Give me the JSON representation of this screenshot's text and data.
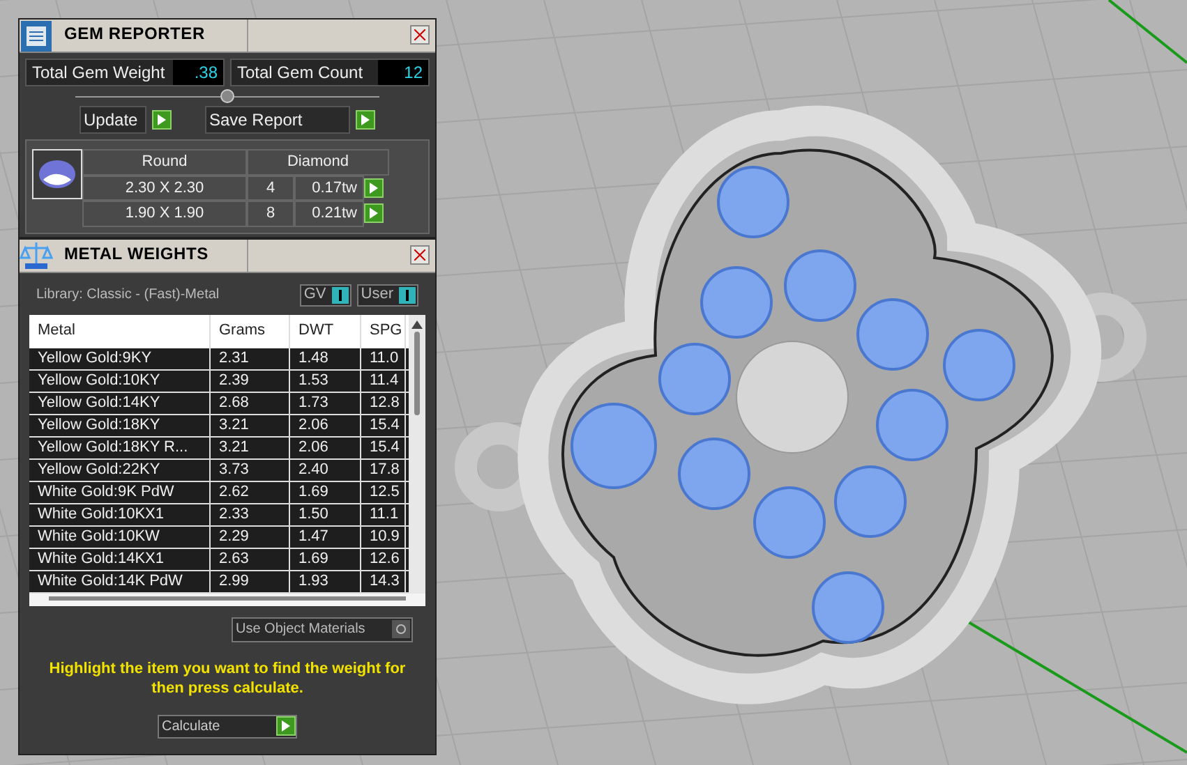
{
  "gem_reporter": {
    "title": "GEM REPORTER",
    "total_weight": {
      "label": "Total Gem Weight",
      "value": ".38"
    },
    "total_count": {
      "label": "Total Gem Count",
      "value": "12"
    },
    "buttons": [
      "Update",
      "Save Report"
    ],
    "gems": {
      "shape": "Round",
      "material": "Diamond",
      "rows": [
        {
          "size": "2.30 X 2.30",
          "count": "4",
          "weight": "0.17tw"
        },
        {
          "size": "1.90 X 1.90",
          "count": "8",
          "weight": "0.21tw"
        }
      ]
    }
  },
  "metal_weights": {
    "title": "METAL WEIGHTS",
    "library": "Library: Classic - (Fast)-Metal",
    "toggles": [
      {
        "label": "GV",
        "on": true
      },
      {
        "label": "User",
        "on": true
      }
    ],
    "table": {
      "columns": [
        "Metal",
        "Grams",
        "DWT",
        "SPG"
      ],
      "rows": [
        [
          "Yellow Gold:9KY",
          "2.31",
          "1.48",
          "11.0"
        ],
        [
          "Yellow Gold:10KY",
          "2.39",
          "1.53",
          "11.4"
        ],
        [
          "Yellow Gold:14KY",
          "2.68",
          "1.73",
          "12.8"
        ],
        [
          "Yellow Gold:18KY",
          "3.21",
          "2.06",
          "15.4"
        ],
        [
          "Yellow Gold:18KY R...",
          "3.21",
          "2.06",
          "15.4"
        ],
        [
          "Yellow Gold:22KY",
          "3.73",
          "2.40",
          "17.8"
        ],
        [
          "White Gold:9K PdW",
          "2.62",
          "1.69",
          "12.5"
        ],
        [
          "White Gold:10KX1",
          "2.33",
          "1.50",
          "11.1"
        ],
        [
          "White Gold:10KW",
          "2.29",
          "1.47",
          "10.9"
        ],
        [
          "White Gold:14KX1",
          "2.63",
          "1.69",
          "12.6"
        ],
        [
          "White Gold:14K PdW",
          "2.99",
          "1.93",
          "14.3"
        ]
      ]
    },
    "use_object_materials": {
      "label": "Use Object Materials",
      "on": false
    },
    "hint": "Highlight the item you want to find the weight for then press calculate.",
    "calculate": "Calculate"
  }
}
